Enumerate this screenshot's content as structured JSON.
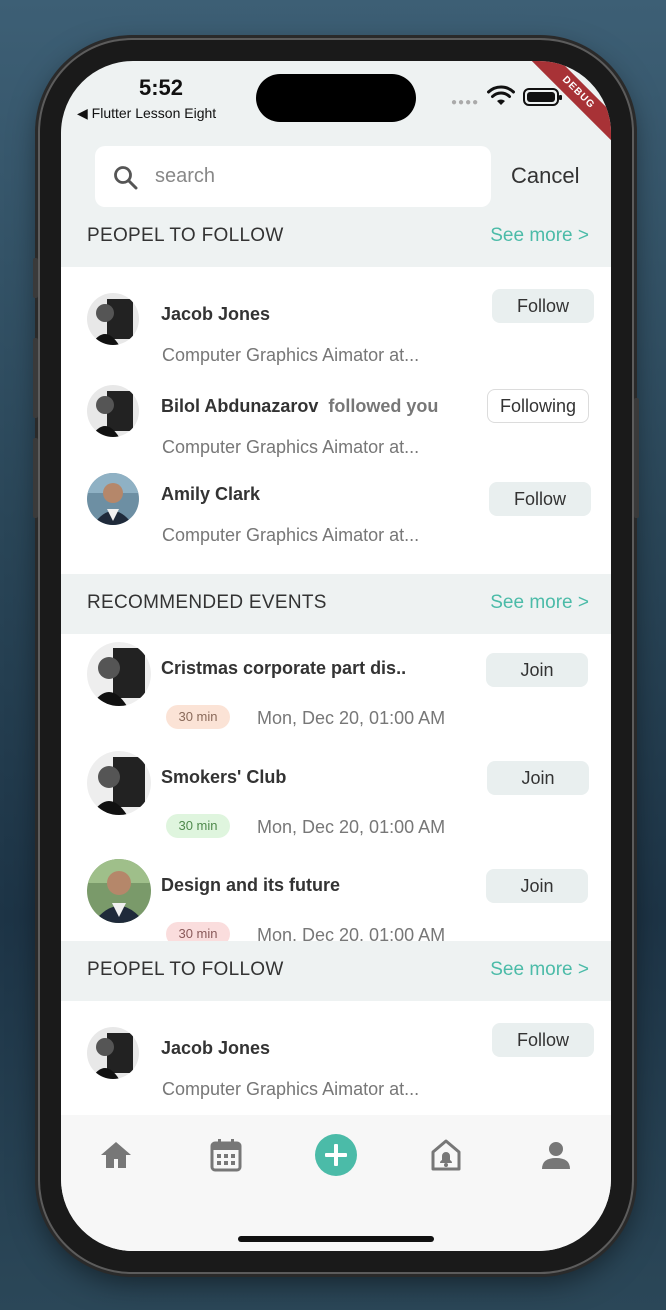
{
  "status_bar": {
    "time": "5:52",
    "back_app": "◀ Flutter Lesson Eight",
    "debug_banner": "DEBUG"
  },
  "search": {
    "placeholder": "search",
    "value": "",
    "cancel_label": "Cancel"
  },
  "colors": {
    "accent": "#4bbba8",
    "background": "#eef2f2",
    "card": "#ffffff",
    "debug": "#a83236"
  },
  "sections": [
    {
      "title": "PEOPEL TO FOLLOW",
      "see_more": "See more >",
      "people": [
        {
          "name": "Jacob Jones",
          "note": "",
          "subtitle": "Computer Graphics Aimator at...",
          "action": "Follow"
        },
        {
          "name": "Bilol Abdunazarov",
          "note": "followed you",
          "subtitle": "Computer Graphics Aimator at...",
          "action": "Following"
        },
        {
          "name": "Amily Clark",
          "note": "",
          "subtitle": "Computer Graphics Aimator at...",
          "action": "Follow"
        }
      ]
    },
    {
      "title": "RECOMMENDED EVENTS",
      "see_more": "See more >",
      "events": [
        {
          "title": "Cristmas corporate part dis..",
          "duration": "30 min",
          "date": "Mon, Dec 20, 01:00 AM",
          "action": "Join"
        },
        {
          "title": "Smokers' Club",
          "duration": "30 min",
          "date": "Mon, Dec 20, 01:00 AM",
          "action": "Join"
        },
        {
          "title": "Design and its future",
          "duration": "30 min",
          "date": "Mon, Dec 20, 01:00 AM",
          "action": "Join"
        }
      ]
    },
    {
      "title": "PEOPEL TO FOLLOW",
      "see_more": "See more >",
      "people": [
        {
          "name": "Jacob Jones",
          "note": "",
          "subtitle": "Computer Graphics Aimator at...",
          "action": "Follow"
        }
      ]
    }
  ],
  "tab_bar": [
    {
      "icon": "home-icon"
    },
    {
      "icon": "calendar-icon"
    },
    {
      "icon": "add-icon"
    },
    {
      "icon": "notification-icon"
    },
    {
      "icon": "profile-icon"
    }
  ]
}
